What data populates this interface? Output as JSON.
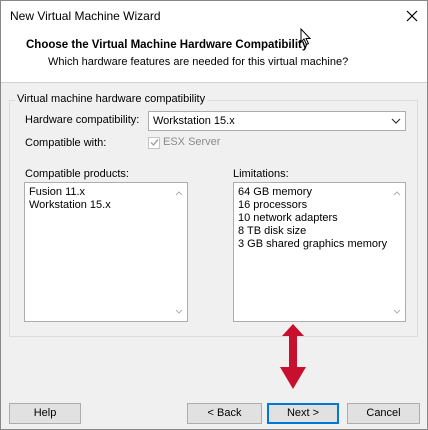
{
  "window": {
    "title": "New Virtual Machine Wizard"
  },
  "header": {
    "title": "Choose the Virtual Machine Hardware Compatibility",
    "subtitle": "Which hardware features are needed for this virtual machine?"
  },
  "group": {
    "legend": "Virtual machine hardware compatibility",
    "hardware_label": "Hardware compatibility:",
    "hardware_value": "Workstation 15.x",
    "compatible_with_label": "Compatible with:",
    "esx_label": "ESX Server",
    "esx_checked": true,
    "esx_enabled": false
  },
  "products": {
    "label": "Compatible products:",
    "items": [
      "Fusion 11.x",
      "Workstation 15.x"
    ]
  },
  "limitations": {
    "label": "Limitations:",
    "items": [
      "64 GB memory",
      "16 processors",
      "10 network adapters",
      "8 TB disk size",
      "3 GB shared graphics memory"
    ]
  },
  "buttons": {
    "help": "Help",
    "back": "< Back",
    "next": "Next >",
    "cancel": "Cancel"
  },
  "annotation": {
    "arrow_color": "#c8102e"
  }
}
